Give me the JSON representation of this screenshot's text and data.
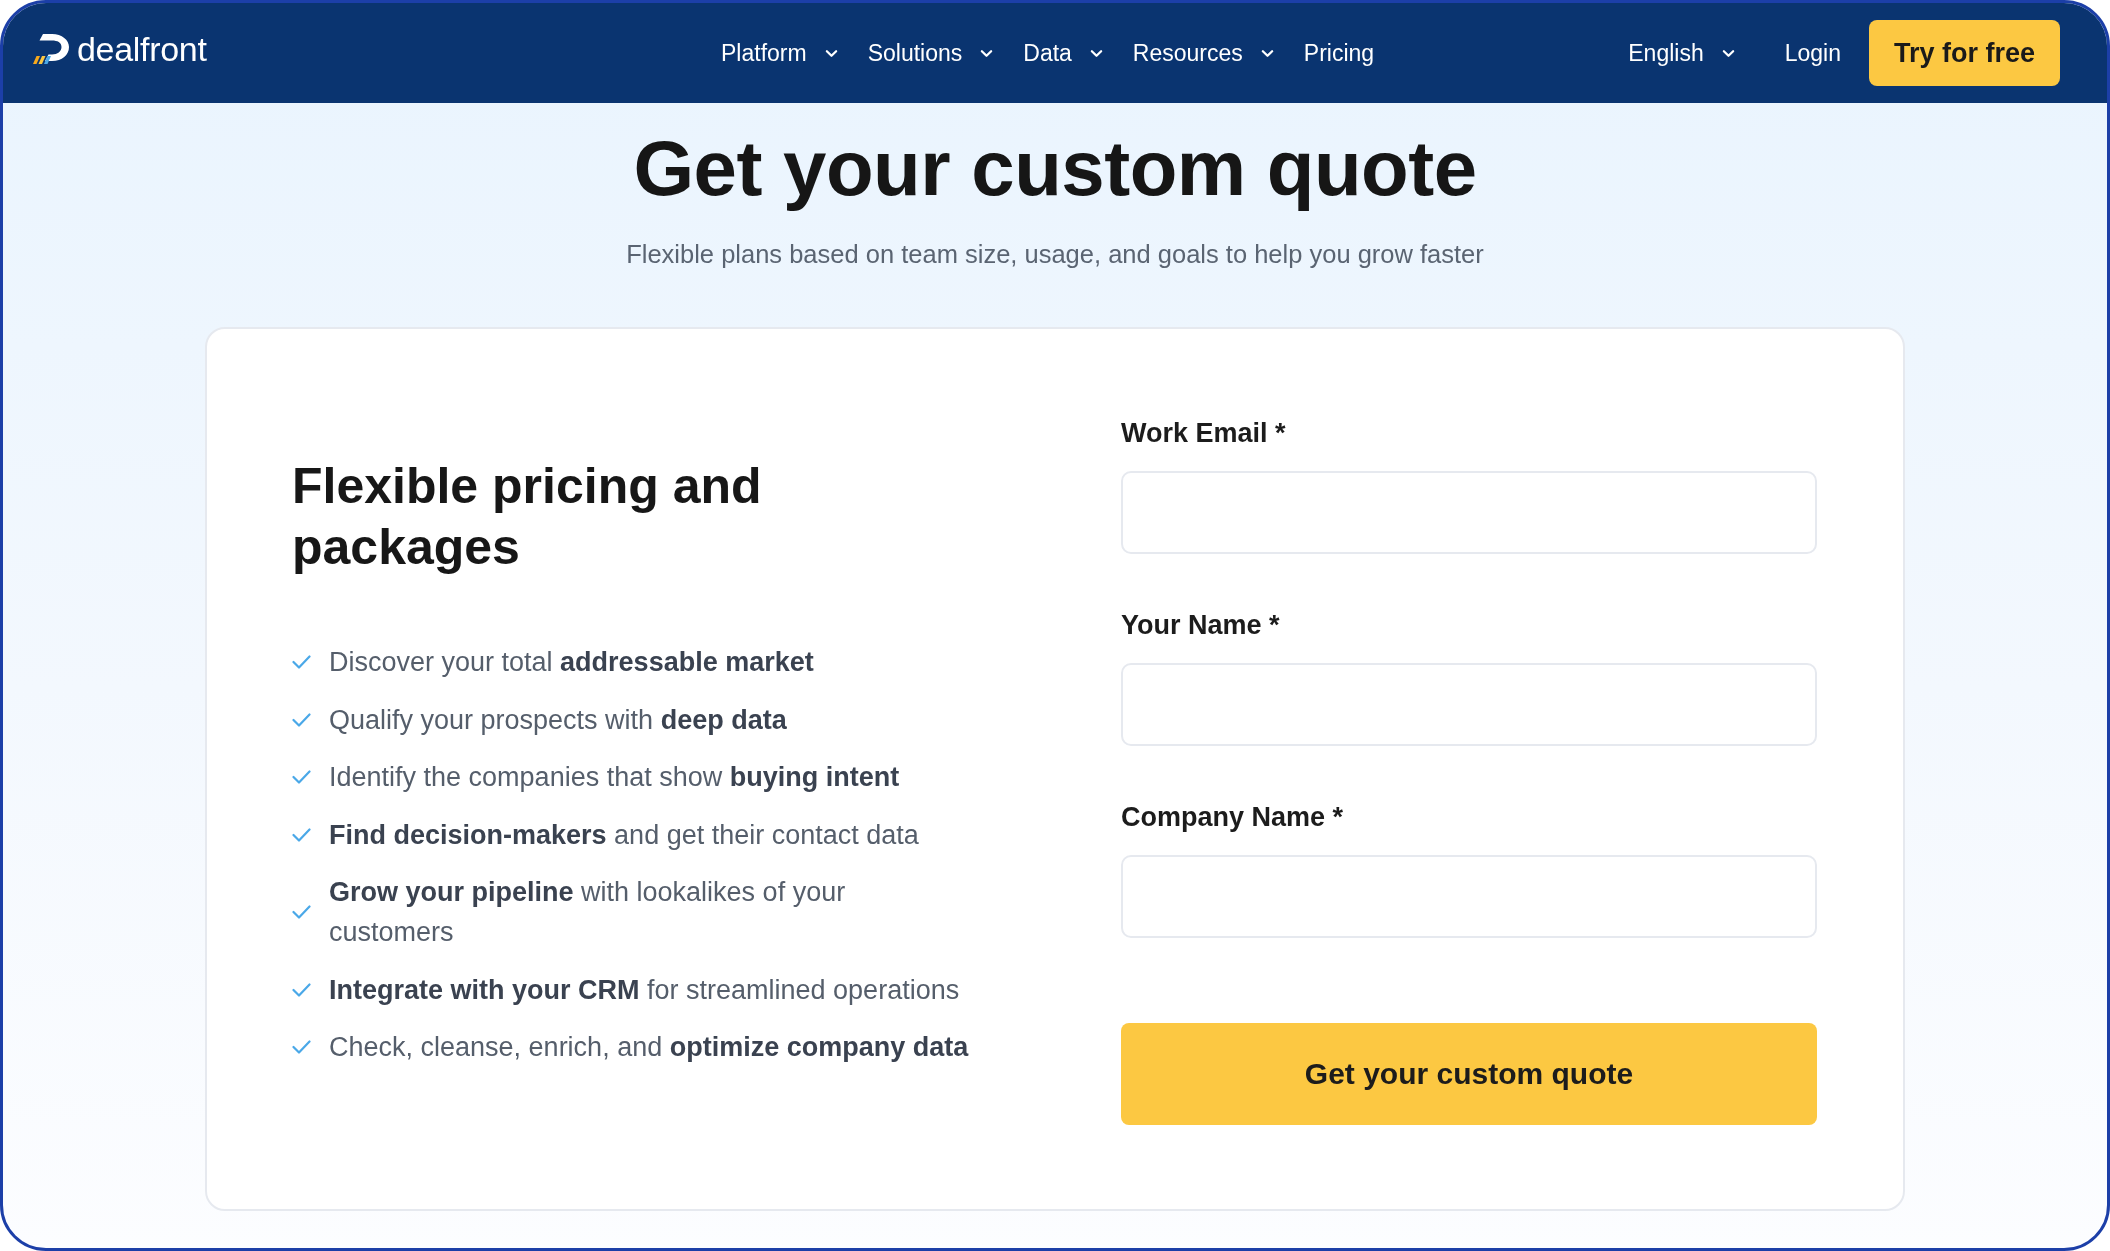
{
  "navbar": {
    "logo": "dealfront",
    "menu": [
      {
        "label": "Platform",
        "kind": "dropdown"
      },
      {
        "label": "Solutions",
        "kind": "dropdown"
      },
      {
        "label": "Data",
        "kind": "dropdown"
      },
      {
        "label": "Resources",
        "kind": "dropdown"
      },
      {
        "label": "Pricing",
        "kind": "link"
      }
    ],
    "language": {
      "label": "English"
    },
    "login": "Login",
    "cta": "Try for free"
  },
  "hero": {
    "title": "Get your custom quote",
    "subtitle": "Flexible plans based on team size, usage, and goals to help you grow faster"
  },
  "card": {
    "heading": "Flexible pricing and packages",
    "features": [
      "Discover your total **addressable market**",
      "Qualify your prospects with **deep data**",
      "Identify the companies that show **buying intent**",
      "**Find decision-makers** and get their contact data",
      "**Grow your pipeline** with lookalikes of your customers",
      "**Integrate with your CRM** for streamlined operations",
      "Check, cleanse, enrich, and **optimize company data**"
    ],
    "form": {
      "fields": [
        {
          "label": "Work Email *"
        },
        {
          "label": "Your Name *"
        },
        {
          "label": "Company Name *"
        }
      ],
      "submit": "Get your custom quote"
    }
  }
}
